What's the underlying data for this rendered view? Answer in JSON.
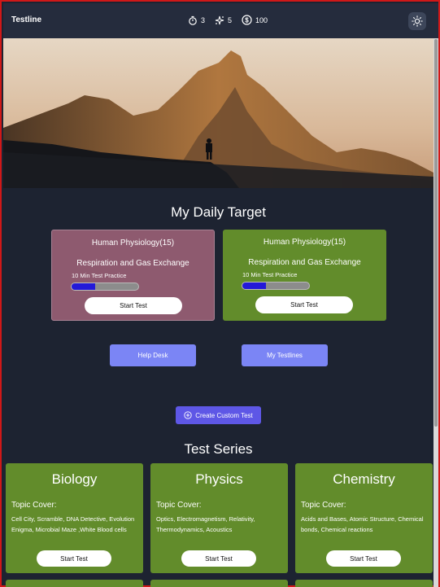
{
  "header": {
    "brand": "Testline",
    "stats": [
      {
        "icon": "stopwatch-icon",
        "value": "3"
      },
      {
        "icon": "sparkle-icon",
        "value": "5"
      },
      {
        "icon": "dollar-coin-icon",
        "value": "100"
      }
    ],
    "theme_toggle_icon": "sun-icon"
  },
  "hero": {
    "image": "mountain-silhouette-hiker"
  },
  "daily_target": {
    "title": "My Daily Target",
    "cards": [
      {
        "subject": "Human Physiology(15)",
        "topic": "Respiration and Gas Exchange",
        "label": "10 Min Test Practice",
        "progress": 0.35,
        "button": "Start Test",
        "color": "#8e5a6f"
      },
      {
        "subject": "Human Physiology(15)",
        "topic": "Respiration and Gas Exchange",
        "label": "10 Min Test Practice",
        "progress": 0.35,
        "button": "Start Test",
        "color": "#628c2b"
      }
    ]
  },
  "actions": {
    "help_desk": "Help Desk",
    "my_testlines": "My Testlines",
    "create_custom": "Create Custom Test"
  },
  "test_series": {
    "title": "Test Series",
    "cards": [
      {
        "name": "Biology",
        "topic_label": "Topic Cover:",
        "topics": "Cell City, Scramble, DNA Detective, Evolution Enigma, Microbial Maze ,White Blood cells",
        "button": "Start Test"
      },
      {
        "name": "Physics",
        "topic_label": "Topic Cover:",
        "topics": "Optics, Electromagnetism, Relativity, Thermodynamics, Acoustics",
        "button": "Start Test"
      },
      {
        "name": "Chemistry",
        "topic_label": "Topic Cover:",
        "topics": "Acids and Bases, Atomic Structure, Chemical bonds, Chemical reactions",
        "button": "Start Test"
      }
    ]
  },
  "colors": {
    "background": "#1d2331",
    "topbar": "#252c3d",
    "accent_button": "#7b85f5",
    "create_button": "#5e57e6",
    "green_card": "#628c2b",
    "mauve_card": "#8e5a6f",
    "progress_fill": "#2319d8",
    "border": "#d01818"
  }
}
